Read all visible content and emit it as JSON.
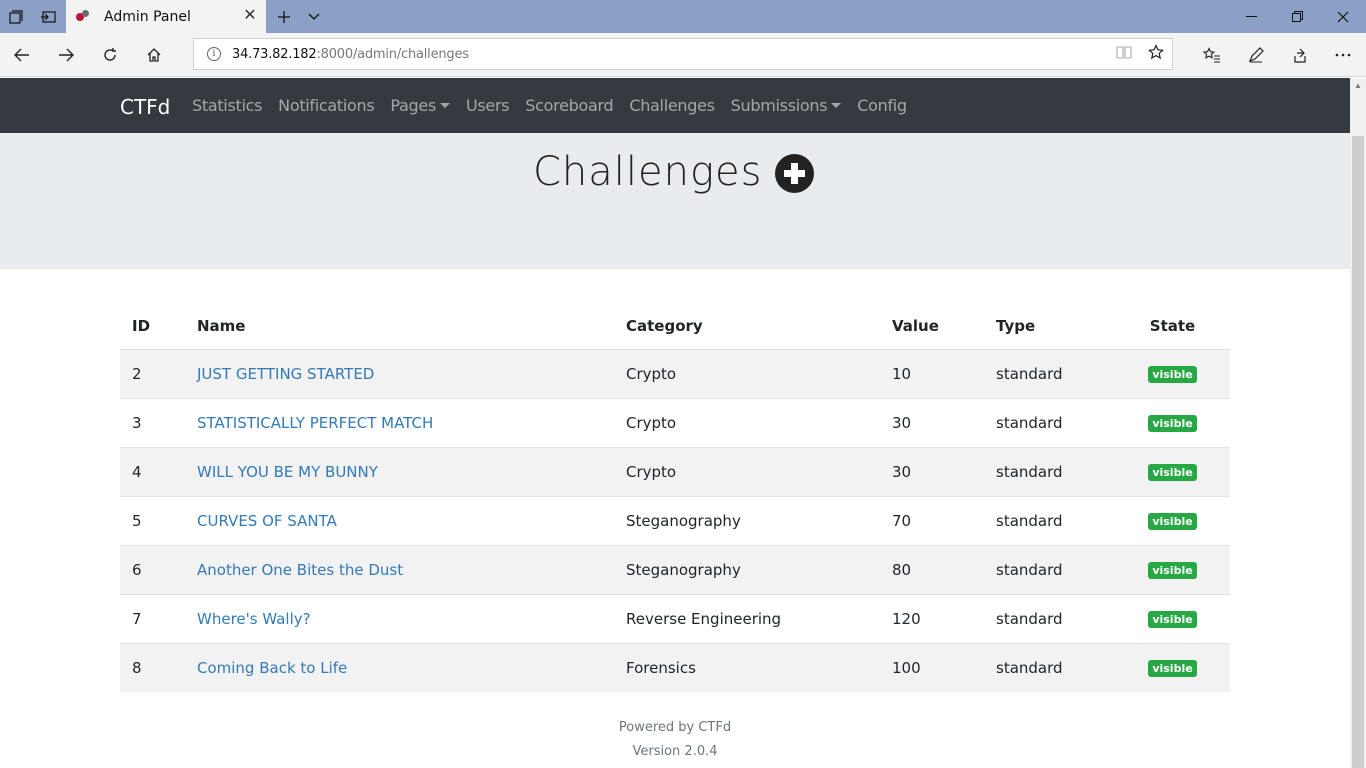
{
  "browser": {
    "tab_title": "Admin Panel",
    "url_host": "34.73.82.182",
    "url_rest": ":8000/admin/challenges"
  },
  "navbar": {
    "brand": "CTFd",
    "items": [
      {
        "label": "Statistics",
        "dropdown": false
      },
      {
        "label": "Notifications",
        "dropdown": false
      },
      {
        "label": "Pages",
        "dropdown": true
      },
      {
        "label": "Users",
        "dropdown": false
      },
      {
        "label": "Scoreboard",
        "dropdown": false
      },
      {
        "label": "Challenges",
        "dropdown": false
      },
      {
        "label": "Submissions",
        "dropdown": true
      },
      {
        "label": "Config",
        "dropdown": false
      }
    ]
  },
  "header": {
    "title": "Challenges"
  },
  "table": {
    "columns": [
      "ID",
      "Name",
      "Category",
      "Value",
      "Type",
      "State"
    ],
    "rows": [
      {
        "id": "2",
        "name": "JUST GETTING STARTED",
        "category": "Crypto",
        "value": "10",
        "type": "standard",
        "state": "visible"
      },
      {
        "id": "3",
        "name": "STATISTICALLY PERFECT MATCH",
        "category": "Crypto",
        "value": "30",
        "type": "standard",
        "state": "visible"
      },
      {
        "id": "4",
        "name": "WILL YOU BE MY BUNNY",
        "category": "Crypto",
        "value": "30",
        "type": "standard",
        "state": "visible"
      },
      {
        "id": "5",
        "name": "CURVES OF SANTA",
        "category": "Steganography",
        "value": "70",
        "type": "standard",
        "state": "visible"
      },
      {
        "id": "6",
        "name": "Another One Bites the Dust",
        "category": "Steganography",
        "value": "80",
        "type": "standard",
        "state": "visible"
      },
      {
        "id": "7",
        "name": "Where's Wally?",
        "category": "Reverse Engineering",
        "value": "120",
        "type": "standard",
        "state": "visible"
      },
      {
        "id": "8",
        "name": "Coming Back to Life",
        "category": "Forensics",
        "value": "100",
        "type": "standard",
        "state": "visible"
      }
    ]
  },
  "footer": {
    "powered": "Powered by CTFd",
    "version": "Version 2.0.4"
  },
  "colors": {
    "navbar_bg": "#343a40",
    "jumbotron_bg": "#e9ecef",
    "link": "#337ab7",
    "badge_visible": "#28a745"
  }
}
